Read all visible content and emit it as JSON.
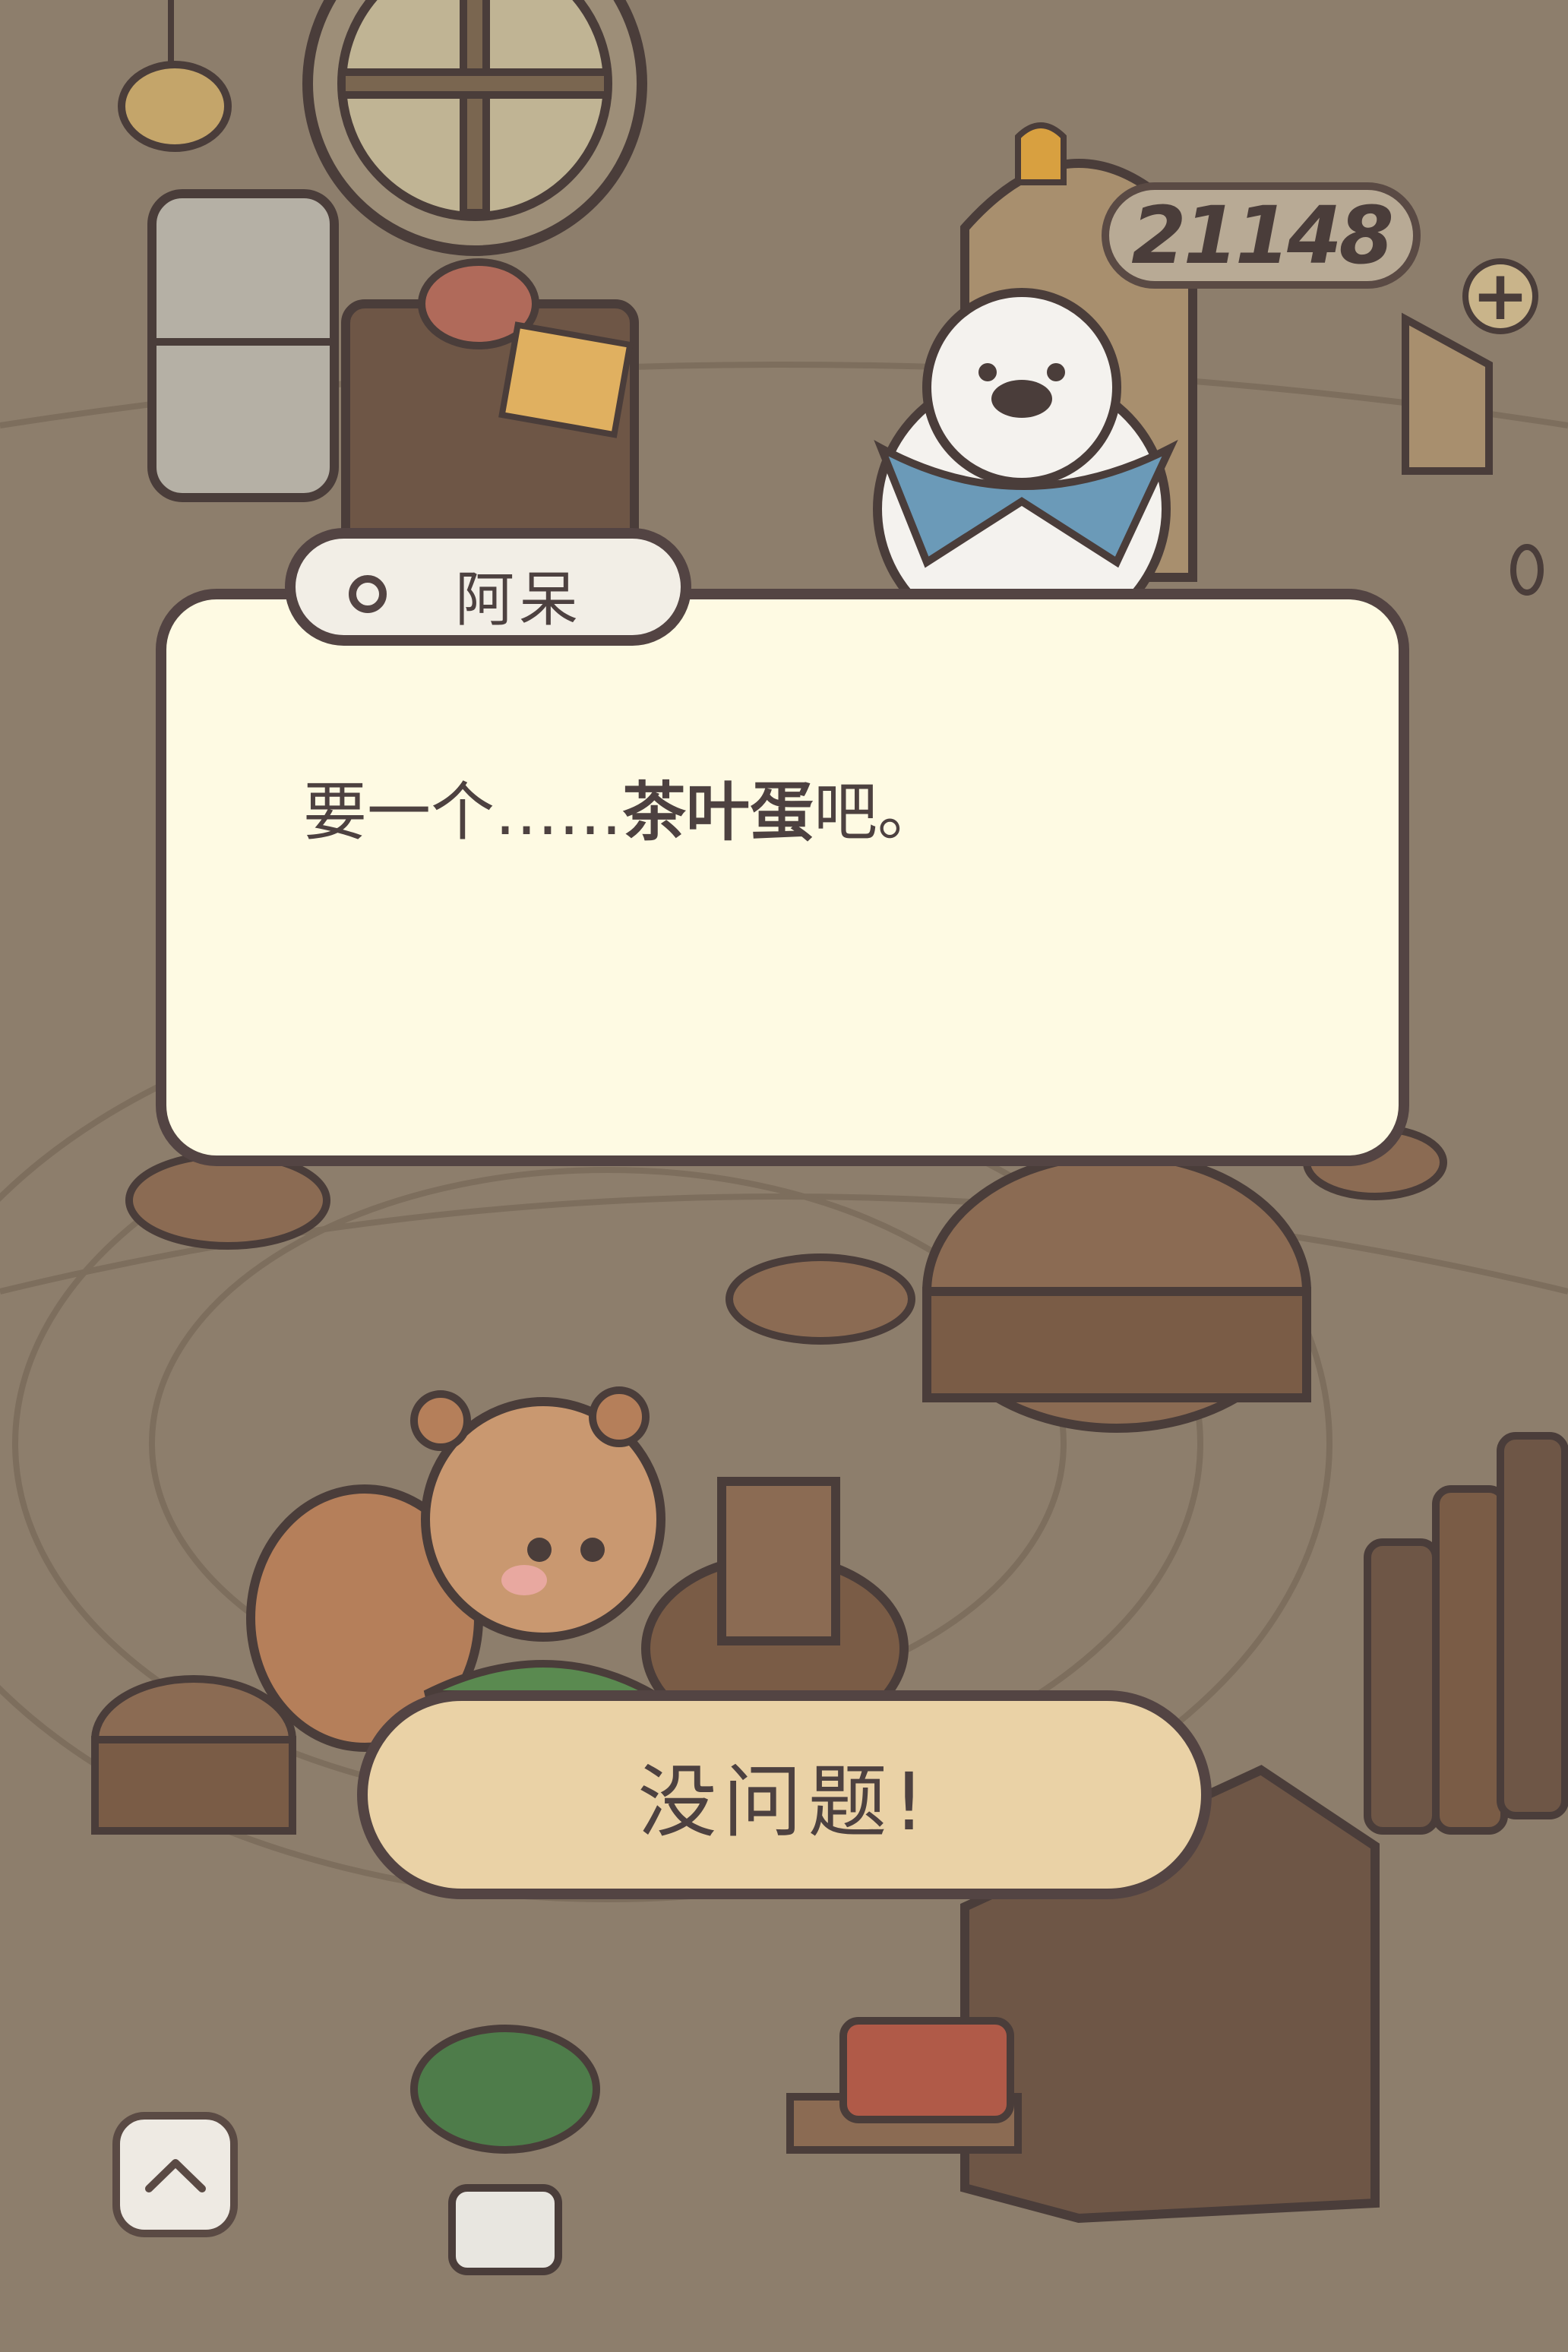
{
  "hud": {
    "coin_count": "21148",
    "add_coins_icon": "plus-icon"
  },
  "dialog": {
    "speaker_name": "阿呆",
    "text_before": "要一个……",
    "text_highlight": "茶叶蛋",
    "text_after": "吧。"
  },
  "actions": {
    "confirm_label": "没问题!"
  },
  "controls": {
    "expand_icon": "chevron-up-icon"
  },
  "colors": {
    "background": "#8d7e6c",
    "dialog_fill": "#fefae3",
    "outline": "#534443",
    "button_fill": "#ead2a6",
    "name_tab_fill": "#f2eee6"
  }
}
